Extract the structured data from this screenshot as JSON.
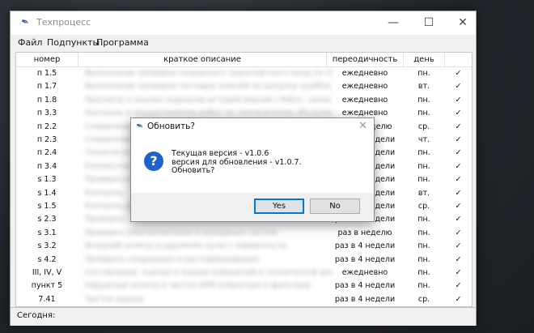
{
  "app": {
    "title": "Техпроцесс",
    "icon": "feather-icon"
  },
  "menu": [
    "Файл",
    "Подпункты",
    "Программа"
  ],
  "table": {
    "columns": [
      "номер",
      "краткое описание",
      "переодичность",
      "день",
      ""
    ],
    "rows": [
      {
        "num": "п 1.5",
        "desc": "Выполнение проверки сохранного транспортного конд по СПМ",
        "period": "ежедневно",
        "day": "пн.",
        "check": "✓"
      },
      {
        "num": "п 1.7",
        "desc": "Выполнение проверки тестовых ключей по выпуску ошибок",
        "period": "ежедневно",
        "day": "вт.",
        "check": "✓"
      },
      {
        "num": "п 1.8",
        "desc": "Просмотр и анализ журналов историй версий ( Работ, связи и",
        "period": "ежедневно",
        "day": "пн.",
        "check": "✓"
      },
      {
        "num": "п 3.3",
        "desc": "Контроль и осуществление работ по техническому обслуживанию",
        "period": "ежедневно",
        "day": "пн.",
        "check": "✓"
      },
      {
        "num": "п 2.2",
        "desc": "Сохранение базы данных",
        "period": "раз в неделю",
        "day": "ср.",
        "check": "✓"
      },
      {
        "num": "п 2.3",
        "desc": "Сохранение",
        "period": "раз в 4 недели",
        "day": "чт.",
        "check": "✓"
      },
      {
        "num": "п 2.4",
        "desc": "Техническое обслуживание",
        "period": "раз в 4 недели",
        "day": "пн.",
        "check": "✓"
      },
      {
        "num": "п 3.4",
        "desc": "Ежемесячный",
        "period": "раз в 4 недели",
        "day": "пн.",
        "check": "✓"
      },
      {
        "num": "s 1.3",
        "desc": "Проверка работоспособности",
        "period": "раз в 4 недели",
        "day": "пн.",
        "check": "✓"
      },
      {
        "num": "s 1.4",
        "desc": "Контроль",
        "period": "раз в 4 недели",
        "day": "вт.",
        "check": "✓"
      },
      {
        "num": "s 1.5",
        "desc": "Контроль работы",
        "period": "раз в 4 недели",
        "day": "ср.",
        "check": "✓"
      },
      {
        "num": "s 2.3",
        "desc": "Проверка",
        "period": "раз в 4 недели",
        "day": "пн.",
        "check": "✓"
      },
      {
        "num": "s 3.1",
        "desc": "Проверка электропитания и резервных систем",
        "period": "раз в неделю",
        "day": "пн.",
        "check": "✓"
      },
      {
        "num": "s 3.2",
        "desc": "Внешний осмотр и удаление пыли с поверхности",
        "period": "раз в 4 недели",
        "day": "пн.",
        "check": "✓"
      },
      {
        "num": "s 4.2",
        "desc": "Проверка соединения и растормаживания",
        "period": "раз в 4 недели",
        "day": "пн.",
        "check": "✓"
      },
      {
        "num": "III, IV, V",
        "desc": "Составление, оценка и анализ изменений в технической документации",
        "period": "ежедневно",
        "day": "пн.",
        "check": "✓"
      },
      {
        "num": "пункт 5",
        "desc": "Наружный осмотр и чистка АРМ оператора и фильтров",
        "period": "раз в 4 недели",
        "day": "пн.",
        "check": "✓"
      },
      {
        "num": "7.41",
        "desc": "Чистка экрана",
        "period": "раз в 4 недели",
        "day": "ср.",
        "check": "✓"
      }
    ]
  },
  "status": {
    "label": "Сегодня:"
  },
  "dialog": {
    "title": "Обновить?",
    "message_line1": "Текущая версия - v1.0.6",
    "message_line2": "версия для обновления - v1.0.7.",
    "message_line3": "Обновить?",
    "yes_label": "Yes",
    "no_label": "No",
    "icon": "question-icon"
  }
}
